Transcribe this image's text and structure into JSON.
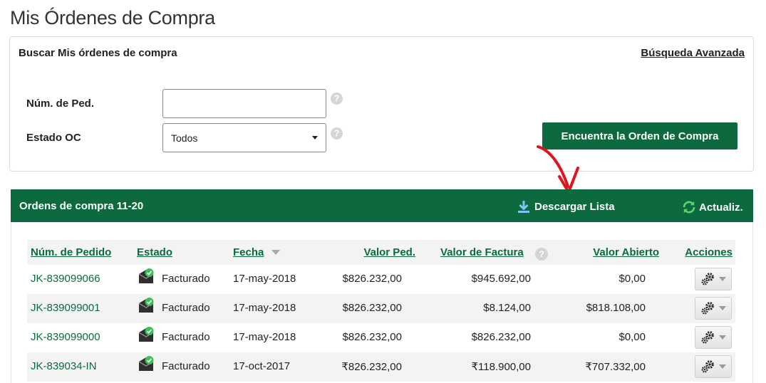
{
  "page": {
    "title": "Mis Órdenes de Compra"
  },
  "search": {
    "heading": "Buscar Mis órdenes de compra",
    "advanced_link": "Búsqueda Avanzada",
    "order_label": "Núm. de Ped.",
    "order_value": "",
    "status_label": "Estado OC",
    "status_value": "Todos",
    "help_glyph": "?",
    "find_button": "Encuentra la Orden de Compra"
  },
  "results": {
    "title": "Ordens de compra 11-20",
    "download_label": "Descargar Lista",
    "refresh_label": "Actualiz.",
    "columns": {
      "order": "Núm. de Pedido",
      "status": "Estado",
      "date": "Fecha",
      "value": "Valor Ped.",
      "invoice": "Valor de Factura",
      "open": "Valor Abierto",
      "actions": "Acciones"
    },
    "rows": [
      {
        "order": "JK-839099066",
        "status": "Facturado",
        "date": "17-may-2018",
        "value": "$826.232,00",
        "invoice": "$945.692,00",
        "open": "$0,00"
      },
      {
        "order": "JK-839099001",
        "status": "Facturado",
        "date": "17-may-2018",
        "value": "$826.232,00",
        "invoice": "$8.124,00",
        "open": "$818.108,00"
      },
      {
        "order": "JK-839099000",
        "status": "Facturado",
        "date": "17-may-2018",
        "value": "$826.232,00",
        "invoice": "$826.232,00",
        "open": "$0,00"
      },
      {
        "order": "JK-839034-IN",
        "status": "Facturado",
        "date": "17-oct-2017",
        "value": "₹826.232,00",
        "invoice": "₹118.900,00",
        "open": "₹707.332,00"
      }
    ]
  },
  "icons": {
    "help": "question-circle-icon",
    "download": "download-icon",
    "refresh": "refresh-icon",
    "status": "invoiced-envelope-icon",
    "actions": "gear-icon",
    "sort": "sort-desc-icon",
    "annotation": "red-arrow-annotation"
  },
  "colors": {
    "brand": "#0c6a3e",
    "annotation": "#e0151b",
    "check": "#3dbf57"
  }
}
